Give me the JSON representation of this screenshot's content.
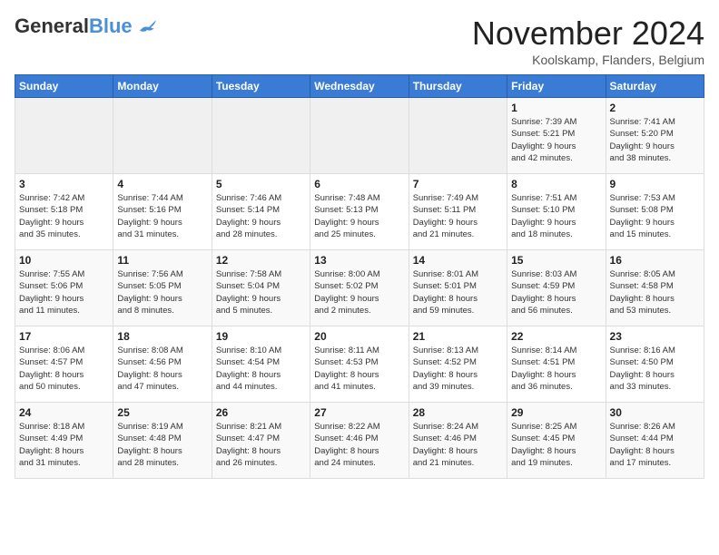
{
  "header": {
    "logo_general": "General",
    "logo_blue": "Blue",
    "title": "November 2024",
    "location": "Koolskamp, Flanders, Belgium"
  },
  "days_of_week": [
    "Sunday",
    "Monday",
    "Tuesday",
    "Wednesday",
    "Thursday",
    "Friday",
    "Saturday"
  ],
  "weeks": [
    {
      "days": [
        {
          "num": "",
          "info": ""
        },
        {
          "num": "",
          "info": ""
        },
        {
          "num": "",
          "info": ""
        },
        {
          "num": "",
          "info": ""
        },
        {
          "num": "",
          "info": ""
        },
        {
          "num": "1",
          "info": "Sunrise: 7:39 AM\nSunset: 5:21 PM\nDaylight: 9 hours\nand 42 minutes."
        },
        {
          "num": "2",
          "info": "Sunrise: 7:41 AM\nSunset: 5:20 PM\nDaylight: 9 hours\nand 38 minutes."
        }
      ]
    },
    {
      "days": [
        {
          "num": "3",
          "info": "Sunrise: 7:42 AM\nSunset: 5:18 PM\nDaylight: 9 hours\nand 35 minutes."
        },
        {
          "num": "4",
          "info": "Sunrise: 7:44 AM\nSunset: 5:16 PM\nDaylight: 9 hours\nand 31 minutes."
        },
        {
          "num": "5",
          "info": "Sunrise: 7:46 AM\nSunset: 5:14 PM\nDaylight: 9 hours\nand 28 minutes."
        },
        {
          "num": "6",
          "info": "Sunrise: 7:48 AM\nSunset: 5:13 PM\nDaylight: 9 hours\nand 25 minutes."
        },
        {
          "num": "7",
          "info": "Sunrise: 7:49 AM\nSunset: 5:11 PM\nDaylight: 9 hours\nand 21 minutes."
        },
        {
          "num": "8",
          "info": "Sunrise: 7:51 AM\nSunset: 5:10 PM\nDaylight: 9 hours\nand 18 minutes."
        },
        {
          "num": "9",
          "info": "Sunrise: 7:53 AM\nSunset: 5:08 PM\nDaylight: 9 hours\nand 15 minutes."
        }
      ]
    },
    {
      "days": [
        {
          "num": "10",
          "info": "Sunrise: 7:55 AM\nSunset: 5:06 PM\nDaylight: 9 hours\nand 11 minutes."
        },
        {
          "num": "11",
          "info": "Sunrise: 7:56 AM\nSunset: 5:05 PM\nDaylight: 9 hours\nand 8 minutes."
        },
        {
          "num": "12",
          "info": "Sunrise: 7:58 AM\nSunset: 5:04 PM\nDaylight: 9 hours\nand 5 minutes."
        },
        {
          "num": "13",
          "info": "Sunrise: 8:00 AM\nSunset: 5:02 PM\nDaylight: 9 hours\nand 2 minutes."
        },
        {
          "num": "14",
          "info": "Sunrise: 8:01 AM\nSunset: 5:01 PM\nDaylight: 8 hours\nand 59 minutes."
        },
        {
          "num": "15",
          "info": "Sunrise: 8:03 AM\nSunset: 4:59 PM\nDaylight: 8 hours\nand 56 minutes."
        },
        {
          "num": "16",
          "info": "Sunrise: 8:05 AM\nSunset: 4:58 PM\nDaylight: 8 hours\nand 53 minutes."
        }
      ]
    },
    {
      "days": [
        {
          "num": "17",
          "info": "Sunrise: 8:06 AM\nSunset: 4:57 PM\nDaylight: 8 hours\nand 50 minutes."
        },
        {
          "num": "18",
          "info": "Sunrise: 8:08 AM\nSunset: 4:56 PM\nDaylight: 8 hours\nand 47 minutes."
        },
        {
          "num": "19",
          "info": "Sunrise: 8:10 AM\nSunset: 4:54 PM\nDaylight: 8 hours\nand 44 minutes."
        },
        {
          "num": "20",
          "info": "Sunrise: 8:11 AM\nSunset: 4:53 PM\nDaylight: 8 hours\nand 41 minutes."
        },
        {
          "num": "21",
          "info": "Sunrise: 8:13 AM\nSunset: 4:52 PM\nDaylight: 8 hours\nand 39 minutes."
        },
        {
          "num": "22",
          "info": "Sunrise: 8:14 AM\nSunset: 4:51 PM\nDaylight: 8 hours\nand 36 minutes."
        },
        {
          "num": "23",
          "info": "Sunrise: 8:16 AM\nSunset: 4:50 PM\nDaylight: 8 hours\nand 33 minutes."
        }
      ]
    },
    {
      "days": [
        {
          "num": "24",
          "info": "Sunrise: 8:18 AM\nSunset: 4:49 PM\nDaylight: 8 hours\nand 31 minutes."
        },
        {
          "num": "25",
          "info": "Sunrise: 8:19 AM\nSunset: 4:48 PM\nDaylight: 8 hours\nand 28 minutes."
        },
        {
          "num": "26",
          "info": "Sunrise: 8:21 AM\nSunset: 4:47 PM\nDaylight: 8 hours\nand 26 minutes."
        },
        {
          "num": "27",
          "info": "Sunrise: 8:22 AM\nSunset: 4:46 PM\nDaylight: 8 hours\nand 24 minutes."
        },
        {
          "num": "28",
          "info": "Sunrise: 8:24 AM\nSunset: 4:46 PM\nDaylight: 8 hours\nand 21 minutes."
        },
        {
          "num": "29",
          "info": "Sunrise: 8:25 AM\nSunset: 4:45 PM\nDaylight: 8 hours\nand 19 minutes."
        },
        {
          "num": "30",
          "info": "Sunrise: 8:26 AM\nSunset: 4:44 PM\nDaylight: 8 hours\nand 17 minutes."
        }
      ]
    }
  ]
}
